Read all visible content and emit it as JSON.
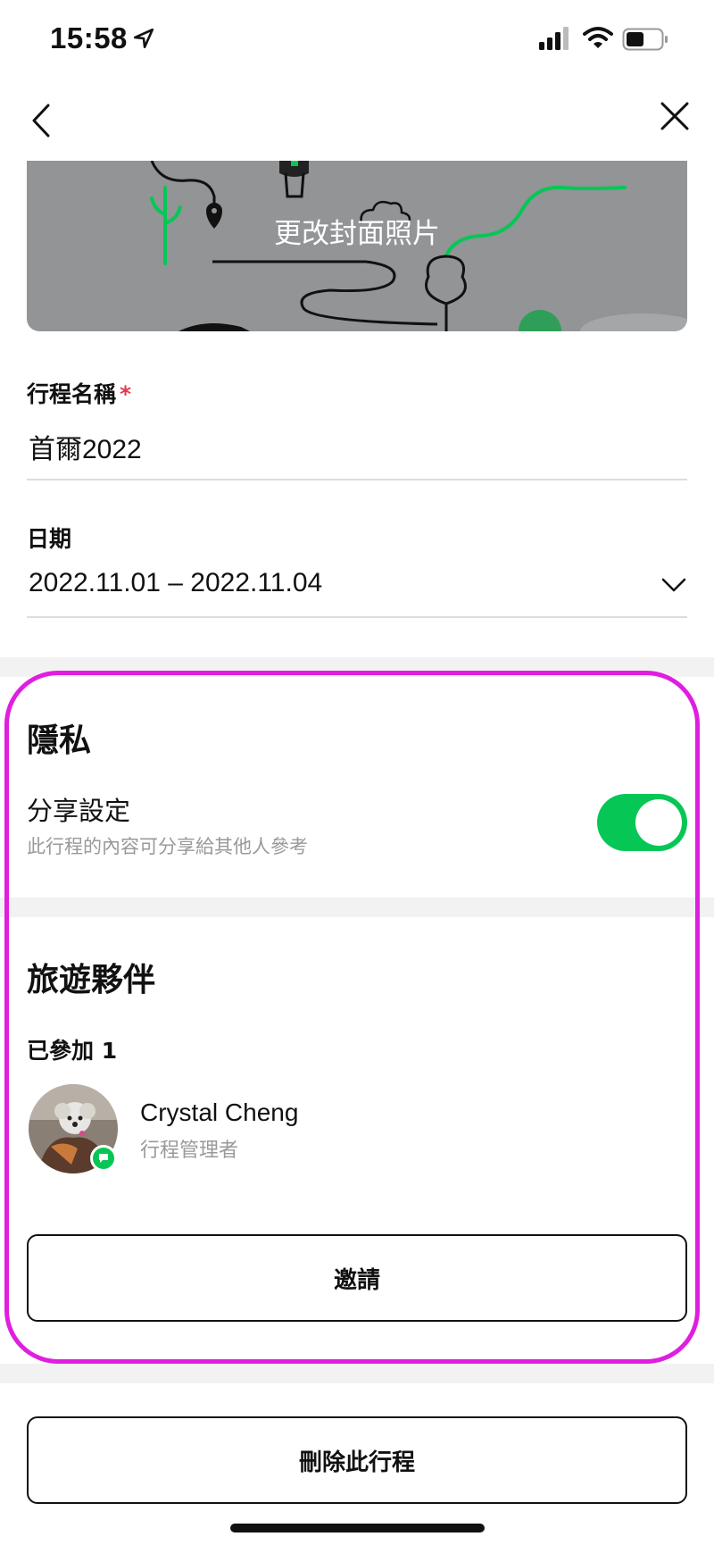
{
  "status_bar": {
    "time": "15:58"
  },
  "cover": {
    "label": "更改封面照片"
  },
  "trip_name": {
    "label": "行程名稱",
    "required_mark": "*",
    "value": "首爾2022"
  },
  "date": {
    "label": "日期",
    "value": "2022.11.01 – 2022.11.04"
  },
  "privacy": {
    "title": "隱私",
    "share_label": "分享設定",
    "share_description": "此行程的內容可分享給其他人參考",
    "share_enabled": true
  },
  "companions": {
    "title": "旅遊夥伴",
    "joined_label": "已參加 1",
    "members": [
      {
        "name": "Crystal Cheng",
        "role": "行程管理者"
      }
    ],
    "invite_label": "邀請"
  },
  "delete_label": "刪除此行程",
  "colors": {
    "accent": "#06c755",
    "highlight": "#e01ee0",
    "required": "#e5384f"
  }
}
